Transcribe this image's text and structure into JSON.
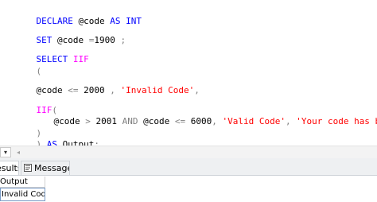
{
  "editor": {
    "line1": {
      "kw1": "DECLARE",
      "var": " @code ",
      "kw2": "AS",
      "sp": " ",
      "kw3": "INT"
    },
    "line2": {
      "kw": "SET",
      "var": " @code ",
      "op": "=",
      "num": "1900",
      "tail": " ",
      "semi": ";"
    },
    "line3": {
      "kw": "SELECT",
      "sp": " ",
      "fn": "IIF"
    },
    "line4": {
      "op": "("
    },
    "line5": {
      "var": "@code ",
      "op": "<=",
      "num": " 2000 ",
      "comma": ",",
      "sp": " ",
      "str": "'Invalid Code'",
      "comma2": ","
    },
    "line6": {
      "fn": "IIF",
      "op": "("
    },
    "line7": {
      "var1": "@code ",
      "op1": ">",
      "num1": " 2001 ",
      "kw": "AND",
      "var2": " @code ",
      "op2": "<=",
      "num2": " 6000",
      "comma1": ",",
      "sp1": " ",
      "str1": "'Valid Code'",
      "comma2": ",",
      "sp2": " ",
      "str2": "'Your code has been Expired'"
    },
    "line8": {
      "op": ")"
    },
    "line9": {
      "op": ")",
      "sp": " ",
      "kw": "AS",
      "var": " Output",
      "semi": ";"
    }
  },
  "scrollbar": {
    "zoom_glyph": "▾",
    "left_arrow": "◂"
  },
  "tabs": {
    "results_label": "esults",
    "messages_label": "Messages"
  },
  "results": {
    "column_header": "Output",
    "cell_value": "Invalid Code"
  },
  "colors": {
    "keyword": "#0000ff",
    "function": "#ff00ff",
    "operator": "#808080",
    "string": "#ff0000"
  }
}
